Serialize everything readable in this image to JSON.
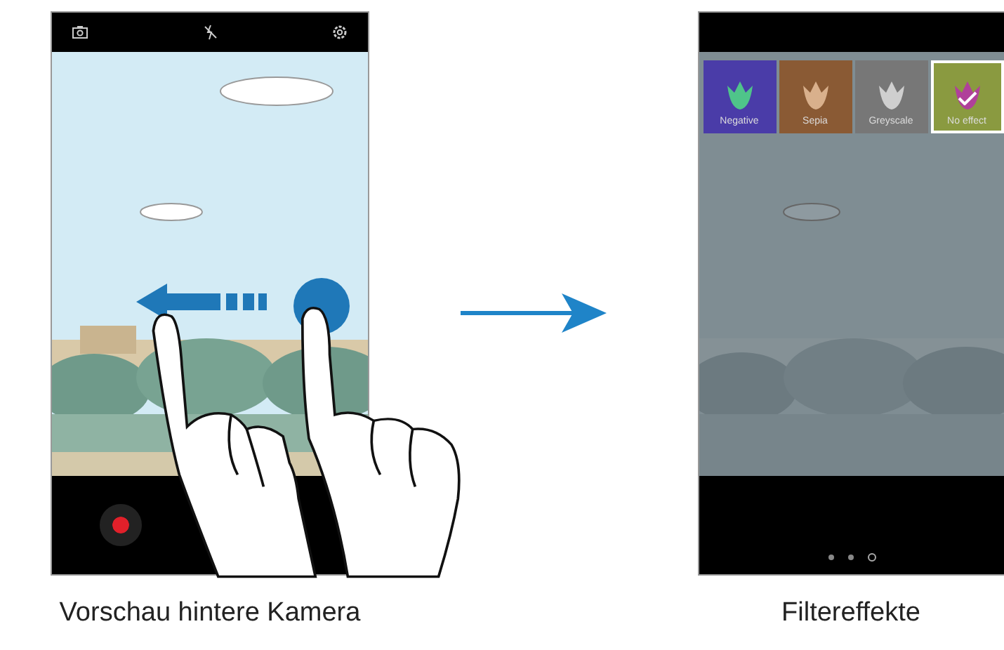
{
  "preview_screen": {
    "caption": "Vorschau hintere Kamera"
  },
  "filter_screen": {
    "filters": [
      {
        "label": "Negative",
        "selected": false
      },
      {
        "label": "Sepia",
        "selected": false
      },
      {
        "label": "Greyscale",
        "selected": false
      },
      {
        "label": "No effect",
        "selected": true
      }
    ],
    "page_dots": [
      {
        "selected": false
      },
      {
        "selected": false
      },
      {
        "selected": true
      }
    ],
    "caption": "Filtereffekte"
  }
}
